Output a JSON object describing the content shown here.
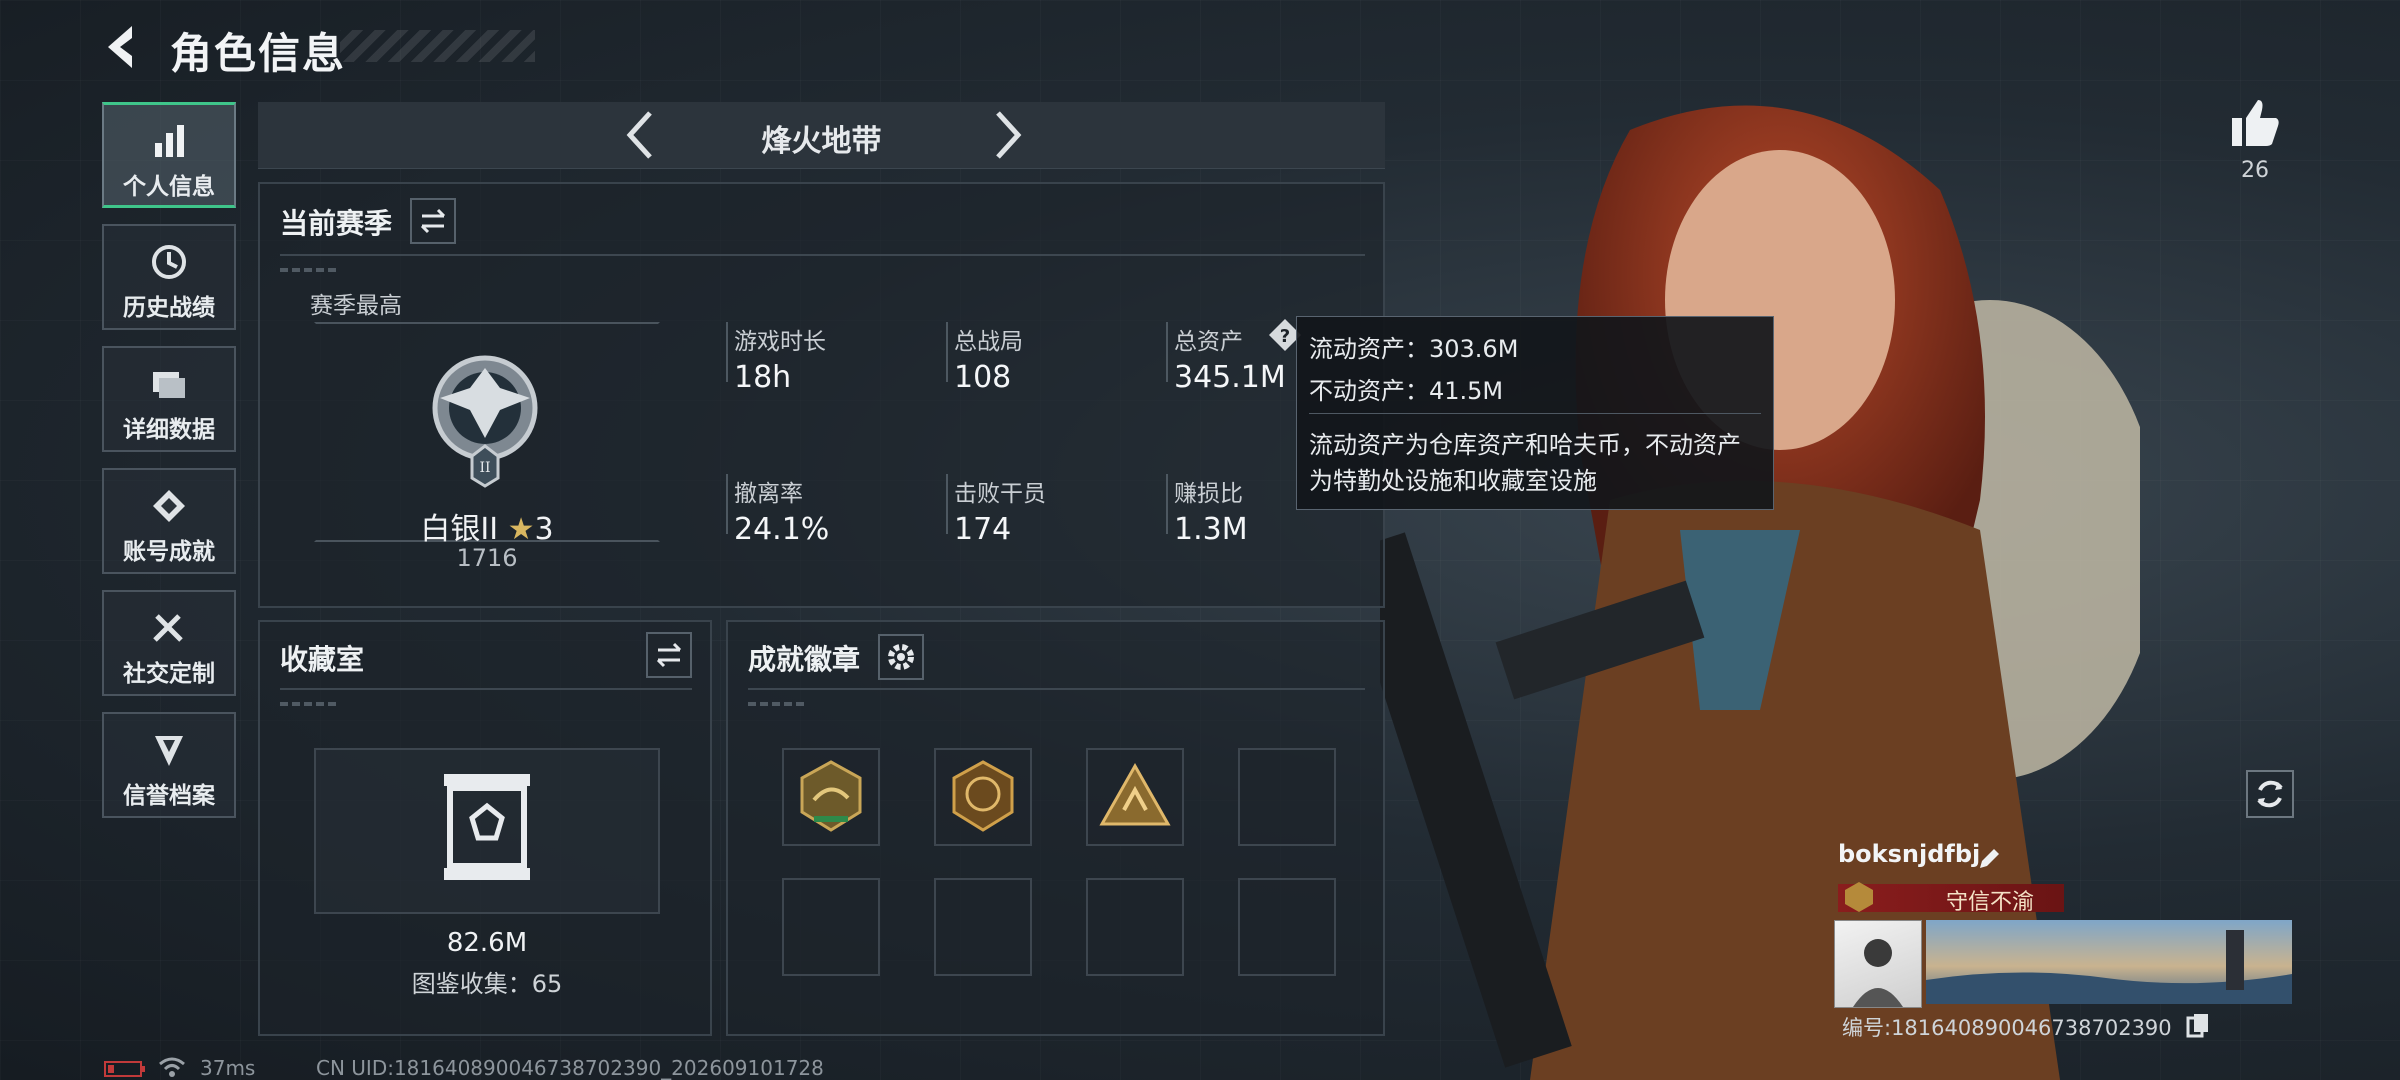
{
  "header": {
    "title": "角色信息"
  },
  "sidebar": {
    "items": [
      {
        "label": "个人信息",
        "icon": "bar-chart-icon"
      },
      {
        "label": "历史战绩",
        "icon": "history-clock-icon"
      },
      {
        "label": "详细数据",
        "icon": "folders-icon"
      },
      {
        "label": "账号成就",
        "icon": "achievement-diamond-icon"
      },
      {
        "label": "社交定制",
        "icon": "tools-icon"
      },
      {
        "label": "信誉档案",
        "icon": "shield-arrow-icon"
      }
    ]
  },
  "mode": {
    "title": "烽火地带"
  },
  "season": {
    "title": "当前赛季",
    "best_label": "赛季最高",
    "rank_name": "白银II",
    "rank_stars": "3",
    "rank_points": "1716",
    "stats": [
      {
        "label": "游戏时长",
        "value": "18h"
      },
      {
        "label": "总战局",
        "value": "108"
      },
      {
        "label": "总资产",
        "value": "345.1M"
      },
      {
        "label": "撤离率",
        "value": "24.1%"
      },
      {
        "label": "击败干员",
        "value": "174"
      },
      {
        "label": "赚损比",
        "value": "1.3M"
      }
    ]
  },
  "tooltip": {
    "line1": "流动资产：303.6M",
    "line2": "不动资产：41.5M",
    "desc1": "流动资产为仓库资产和哈夫币，不动资产",
    "desc2": "为特勤处设施和收藏室设施"
  },
  "collection": {
    "title": "收藏室",
    "value": "82.6M",
    "catalog": "图鉴收集：65"
  },
  "achievements": {
    "title": "成就徽章",
    "badges_filled": 3,
    "slots": 8
  },
  "likes": {
    "count": "26"
  },
  "profile": {
    "name": "boksnjdfbj",
    "title": "守信不渝",
    "id_label": "编号:18164089004673870​2390"
  },
  "footer": {
    "ping": "37ms",
    "uid": "CN UID:18164089004673870​2390_202609101728"
  },
  "colors": {
    "accent": "#3fc58a",
    "rank_title_bg": "#8a1d1d",
    "star": "#d9b760"
  }
}
